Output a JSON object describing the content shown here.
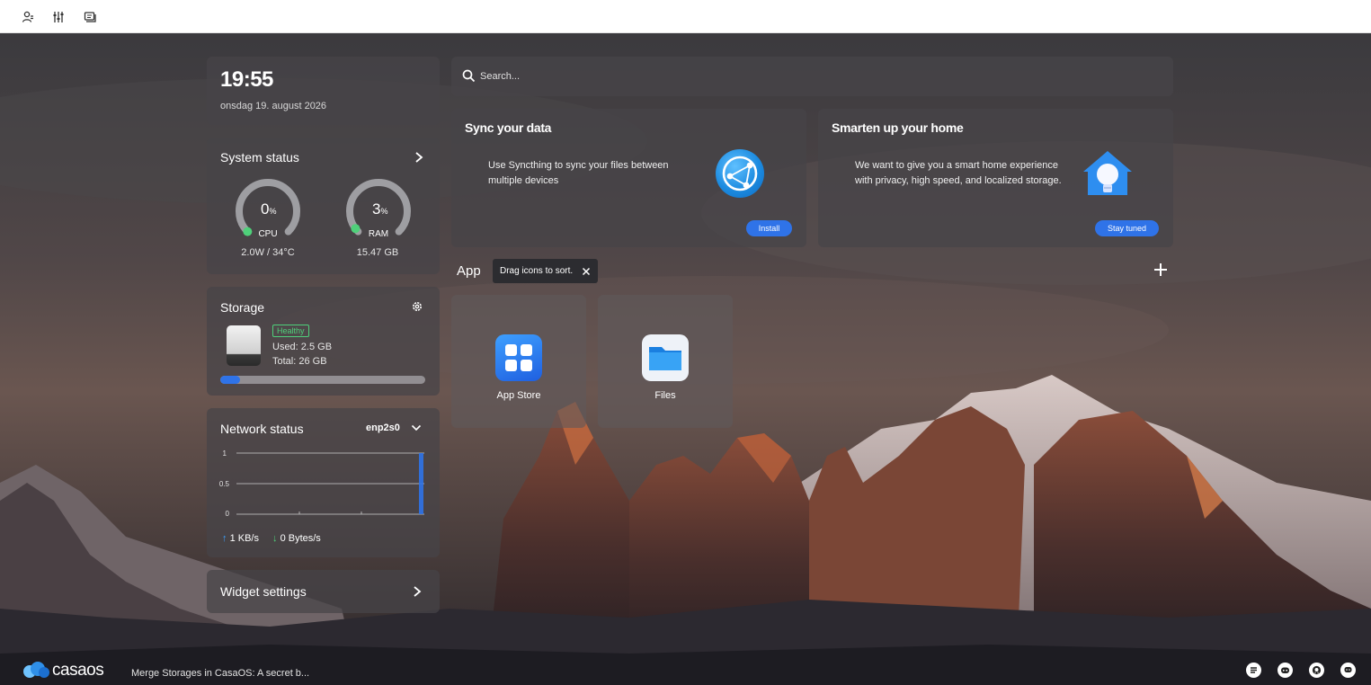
{
  "topbar": {
    "icons": [
      "account-icon",
      "settings-sliders-icon",
      "dashboard-icon"
    ]
  },
  "clock": {
    "time": "19:55",
    "date": "onsdag 19. august 2026"
  },
  "system_status": {
    "title": "System status",
    "cpu": {
      "value": "0",
      "unit": "%",
      "label": "CPU",
      "sub": "2.0W / 34°C",
      "fraction": 0.0
    },
    "ram": {
      "value": "3",
      "unit": "%",
      "label": "RAM",
      "sub": "15.47 GB",
      "fraction": 0.03
    }
  },
  "storage": {
    "title": "Storage",
    "status": "Healthy",
    "used": "Used: 2.5 GB",
    "total": "Total: 26 GB",
    "fraction": 0.096
  },
  "network": {
    "title": "Network status",
    "interface": "enp2s0",
    "ticks": [
      "1",
      "0.5",
      "0"
    ],
    "upload": "1 KB/s",
    "download": "0 Bytes/s"
  },
  "widget_settings": {
    "label": "Widget settings"
  },
  "search": {
    "placeholder": "Search..."
  },
  "promos": [
    {
      "title": "Sync your data",
      "text_line1": "Use Syncthing to sync your files between",
      "text_line2": "multiple devices",
      "button": "Install"
    },
    {
      "title": "Smarten up your home",
      "text_line1": "We want to give you a smart home experience",
      "text_line2": "with privacy, high speed, and localized storage.",
      "button": "Stay tuned"
    }
  ],
  "apps_section": {
    "title": "App",
    "tooltip": "Drag icons to sort.",
    "apps": [
      {
        "name": "App Store",
        "icon": "app-store-icon",
        "color": "#2f7cf0"
      },
      {
        "name": "Files",
        "icon": "folder-icon",
        "color": "#1f8ee6"
      }
    ]
  },
  "footer": {
    "logo_text": "casaos",
    "news": "Merge Storages in CasaOS: A secret b...",
    "icons": [
      "feedback-icon",
      "discord-icon",
      "github-icon",
      "chat-icon"
    ]
  },
  "colors": {
    "accent": "#2f73e8",
    "healthy": "#4fd07a",
    "gauge_track": "#9e9ea2",
    "gauge_dot": "#4fd07a"
  }
}
